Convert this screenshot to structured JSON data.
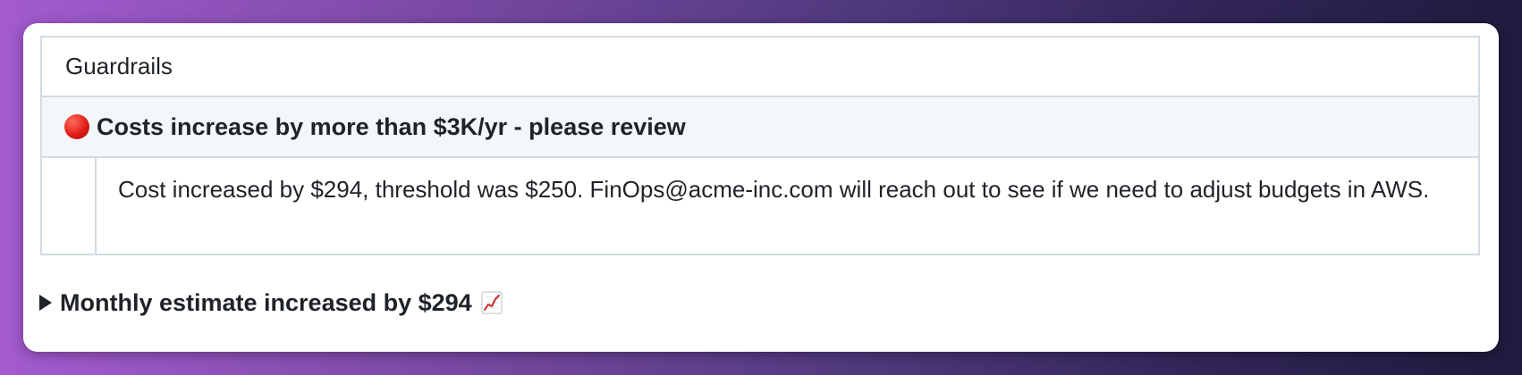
{
  "guardrails": {
    "header": "Guardrails",
    "alert_title": "Costs increase by more than $3K/yr - please review",
    "alert_icon": "red-circle-icon",
    "detail_text": "Cost increased by $294, threshold was $250. FinOps@acme-inc.com will reach out to see if we need to adjust budgets in AWS."
  },
  "summary": {
    "label": "Monthly estimate increased by $294",
    "icon": "chart-increasing-icon"
  },
  "colors": {
    "alert_red": "#e11d17",
    "border": "#d2dbe1",
    "alert_row_bg": "#f4f7fa",
    "text": "#1f2328"
  }
}
